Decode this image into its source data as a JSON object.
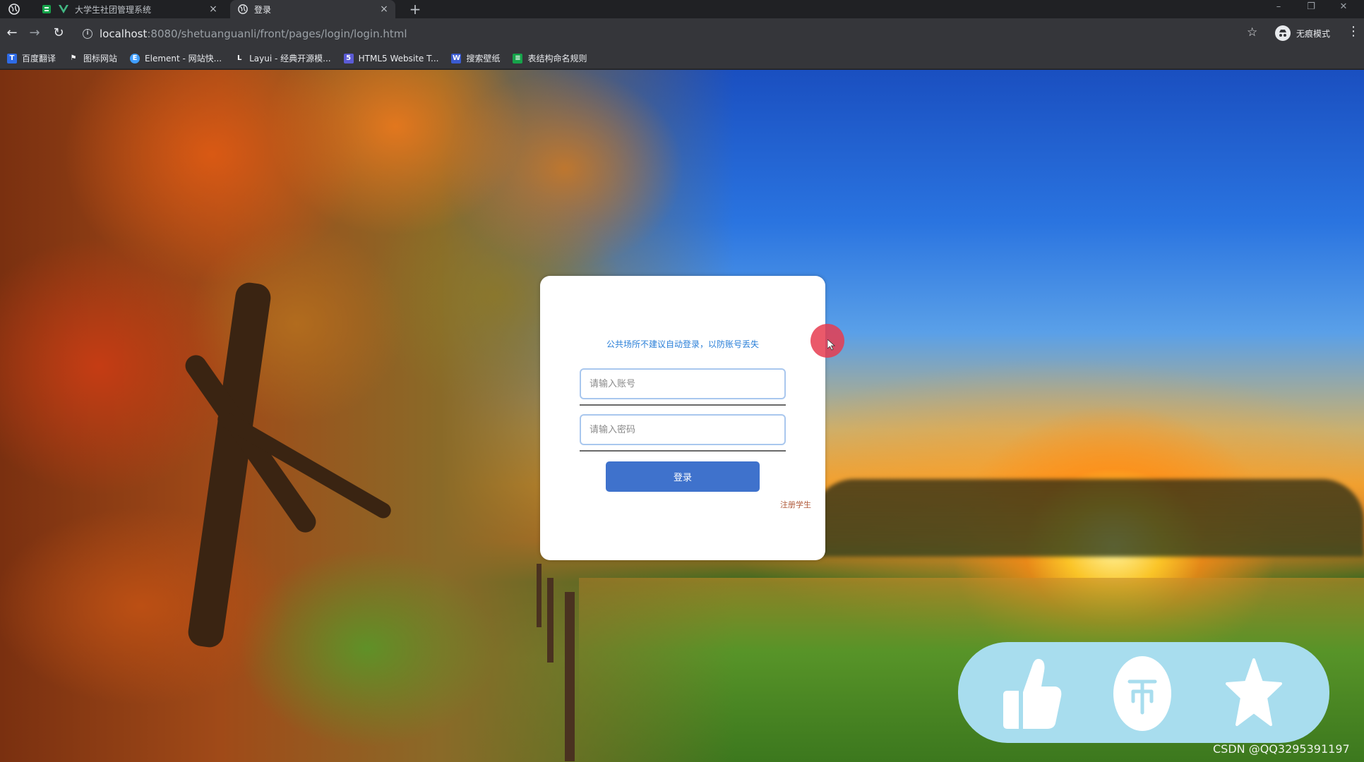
{
  "browser": {
    "tabs": [
      {
        "title": "大学生社团管理系统",
        "icon": "vue-icon",
        "active": false
      },
      {
        "title": "登录",
        "icon": "globe-icon",
        "active": true
      }
    ],
    "new_tab_label": "+",
    "close_glyph": "×",
    "url": {
      "host": "localhost",
      "rest": ":8080/shetuanguanli/front/pages/login/login.html"
    },
    "profile_label": "无痕模式",
    "bookmarks": [
      {
        "label": "百度翻译",
        "icon": "baidu-translate-icon",
        "color": "#2e6be6"
      },
      {
        "label": "图标网站",
        "icon": "flag-icon",
        "color": "#35363a"
      },
      {
        "label": "Element - 网站快...",
        "icon": "element-icon",
        "color": "#409eff"
      },
      {
        "label": "Layui - 经典开源模...",
        "icon": "layui-icon",
        "color": "#35363a"
      },
      {
        "label": "HTML5 Website T...",
        "icon": "html5-icon",
        "color": "#5b5bd6"
      },
      {
        "label": "搜索壁纸",
        "icon": "wallpaper-icon",
        "color": "#3a5bd0"
      },
      {
        "label": "表结构命名规则",
        "icon": "sheet-icon",
        "color": "#16a34a"
      }
    ]
  },
  "login": {
    "tip": "公共场所不建议自动登录，以防账号丢失",
    "account_placeholder": "请输入账号",
    "password_placeholder": "请输入密码",
    "login_label": "登录",
    "register_label": "注册学生"
  },
  "actions": {
    "like_icon": "thumbs-up-icon",
    "coin_icon": "coin-icon",
    "favorite_icon": "star-icon",
    "color": "#a8ddee"
  },
  "watermark": "CSDN @QQ3295391197"
}
